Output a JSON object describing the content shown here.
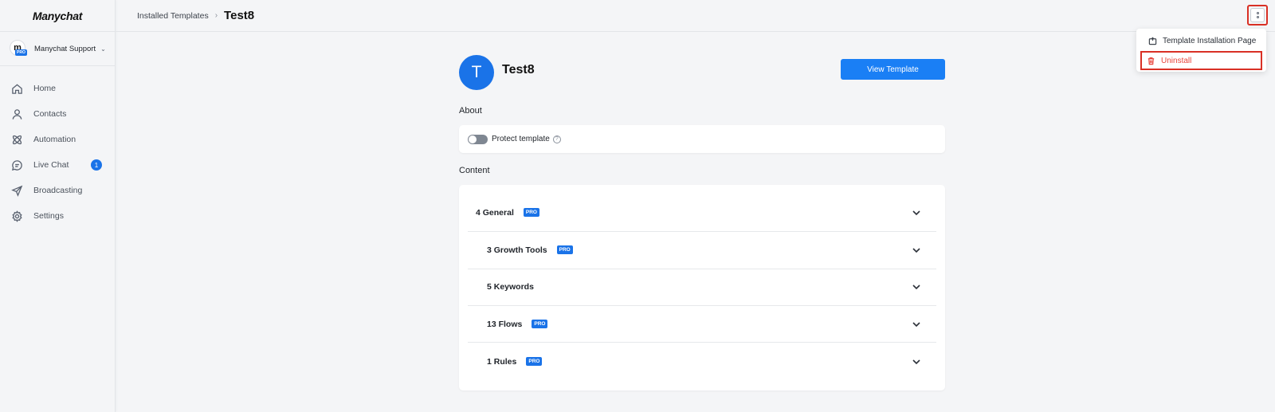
{
  "app": {
    "logo": "Manychat"
  },
  "account": {
    "avatar_letter": "m",
    "badge": "PRO",
    "name": "Manychat Support"
  },
  "sidebar": {
    "items": [
      {
        "label": "Home",
        "icon": "home-icon"
      },
      {
        "label": "Contacts",
        "icon": "user-icon"
      },
      {
        "label": "Automation",
        "icon": "automation-icon"
      },
      {
        "label": "Live Chat",
        "icon": "chat-icon",
        "badge": "1"
      },
      {
        "label": "Broadcasting",
        "icon": "send-icon"
      },
      {
        "label": "Settings",
        "icon": "gear-icon"
      }
    ]
  },
  "header": {
    "breadcrumb_parent": "Installed Templates",
    "breadcrumb_current": "Test8"
  },
  "dropdown": {
    "items": [
      {
        "label": "Template Installation Page",
        "icon": "external-page-icon"
      },
      {
        "label": "Uninstall",
        "icon": "trash-icon",
        "color": "#e8453c"
      }
    ]
  },
  "template": {
    "avatar_letter": "T",
    "name": "Test8",
    "view_button": "View Template"
  },
  "about": {
    "heading": "About",
    "protect_label": "Protect template",
    "help": "?"
  },
  "content": {
    "heading": "Content",
    "rows": [
      {
        "label": "4 General",
        "badge": "PRO"
      },
      {
        "label": "3 Growth Tools",
        "badge": "PRO"
      },
      {
        "label": "5 Keywords",
        "badge": ""
      },
      {
        "label": "13 Flows",
        "badge": "PRO"
      },
      {
        "label": "1 Rules",
        "badge": "PRO"
      }
    ]
  },
  "colors": {
    "accent": "#1a73e8",
    "danger": "#e8453c"
  }
}
